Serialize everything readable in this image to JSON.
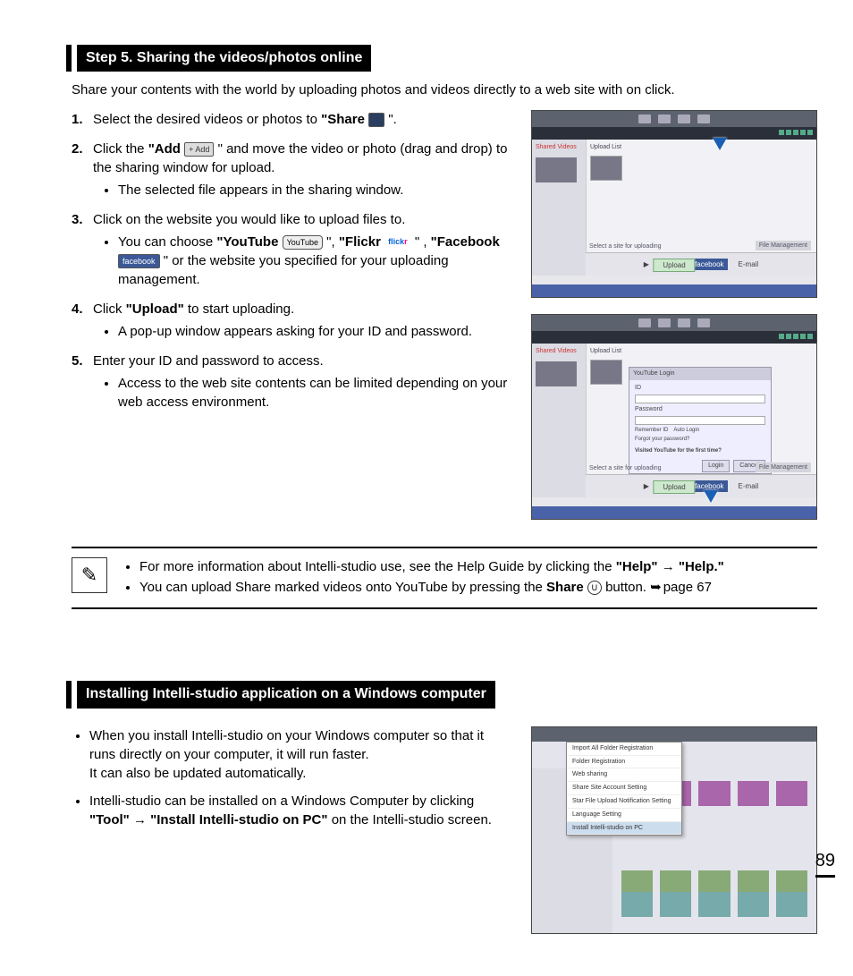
{
  "section1": {
    "header": "Step 5. Sharing the videos/photos online",
    "intro": "Share your contents with the world by uploading photos and videos directly to a web site with on click.",
    "steps": [
      {
        "num": "1.",
        "text_a": "Select the desired videos or photos to ",
        "bold_a": "\"Share",
        "text_b": "\"."
      },
      {
        "num": "2.",
        "text_a": "Click the ",
        "bold_a": "\"Add",
        "text_b": "\" and move the video or photo (drag and drop) to the sharing window for upload.",
        "sub": [
          "The selected file appears in the sharing window."
        ]
      },
      {
        "num": "3.",
        "text_a": "Click on the website you would like to upload files to.",
        "sub_rich": {
          "pre": "You can choose ",
          "youtube": "\"YouTube",
          "mid1": "\", ",
          "flickr": "\"Flickr",
          "mid2": "\" , ",
          "facebook": "\"Facebook",
          "post": "\" or the website you specified for your uploading management."
        }
      },
      {
        "num": "4.",
        "text_a": "Click ",
        "bold_a": "\"Upload\"",
        "text_b": " to start uploading.",
        "sub": [
          "A pop-up window appears asking for your ID and password."
        ]
      },
      {
        "num": "5.",
        "text_a": "Enter your ID and password to access.",
        "sub": [
          "Access to the web site contents can be limited depending on your web access environment."
        ]
      }
    ]
  },
  "icons": {
    "add_label": "+ Add",
    "youtube_label": "YouTube",
    "facebook_label": "facebook",
    "share_round": "U"
  },
  "screenshots": {
    "side_label": "Shared Videos",
    "main_label": "Upload List",
    "select_label": "Select a site for uploading",
    "file_mgmt": "File Management",
    "flickr": "flickr",
    "facebook": "facebook",
    "email": "E-mail",
    "upload_btn": "Upload",
    "login": {
      "title": "YouTube Login",
      "id": "ID",
      "pw": "Password",
      "remember": "Remember ID",
      "autologin": "Auto Login",
      "forgot": "Forgot your password?",
      "firsttime": "Visited YouTube for the first time?",
      "btn_login": "Login",
      "btn_cancel": "Cancel"
    }
  },
  "note": {
    "line1_a": "For more information about Intelli-studio use, see the Help Guide by clicking the ",
    "line1_b": "\"Help\"",
    "line1_c": "\"Help.\"",
    "line2_a": "You can upload Share marked videos onto YouTube by pressing the ",
    "line2_b": "Share",
    "line2_c": " button. ",
    "line2_d": "page 67"
  },
  "section2": {
    "header": "Installing Intelli-studio application on a Windows computer",
    "bullets": [
      {
        "a": "When you install Intelli-studio on your Windows computer so that it runs directly on your computer, it will run faster.",
        "b": "It can also be updated automatically."
      },
      {
        "a": "Intelli-studio can be installed on a Windows Computer by clicking ",
        "bold1": "\"Tool\"",
        "bold2": "\"Install Intelli-studio on PC\"",
        "c": " on the Intelli-studio screen."
      }
    ],
    "menu_items": [
      "Import All Folder Registration",
      "Folder Registration",
      "Web sharing",
      "Share Site Account Setting",
      "Star File Upload Notification Setting",
      "Language Setting",
      "Install Intelli-studio on PC"
    ]
  },
  "page_number": "89"
}
